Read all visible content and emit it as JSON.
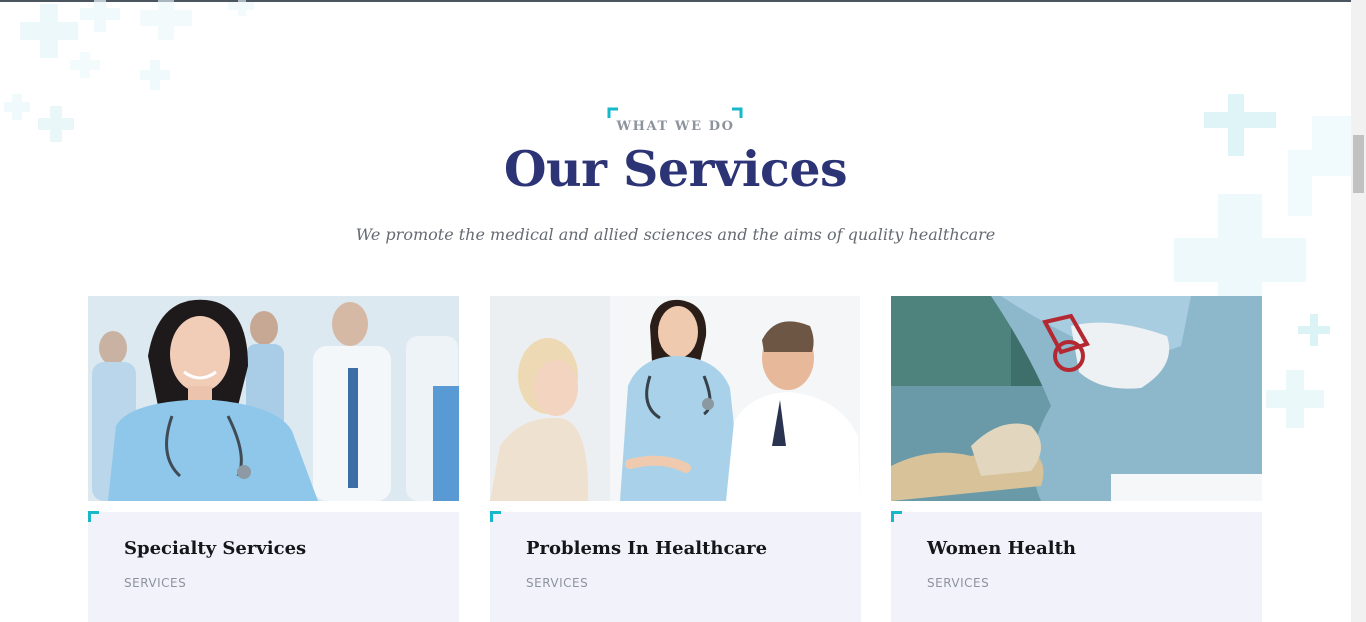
{
  "section": {
    "eyebrow": "WHAT WE DO",
    "title": "Our Services",
    "subtitle": "We promote the medical and allied sciences and the aims of quality healthcare"
  },
  "cards": [
    {
      "title": "Specialty Services",
      "tag": "SERVICES",
      "image": "smiling-nurse-with-staff-photo"
    },
    {
      "title": "Problems In Healthcare",
      "tag": "SERVICES",
      "image": "doctors-consulting-patient-photo"
    },
    {
      "title": "Women Health",
      "tag": "SERVICES",
      "image": "surgeon-operating-photo"
    }
  ],
  "colors": {
    "accent": "#16b8c9",
    "title": "#2c3476",
    "card_bg": "#f2f3fa",
    "decor": "#e3f6f8"
  },
  "icons": [
    "medical-cross-decor"
  ]
}
